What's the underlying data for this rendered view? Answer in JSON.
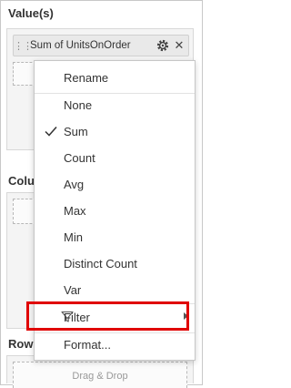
{
  "values_section": {
    "title": "Value(s)",
    "pill_label": "Sum of UnitsOnOrder",
    "close_glyph": "✕"
  },
  "columns_section": {
    "title": "Colu"
  },
  "rows_section": {
    "title": "Row",
    "drop_text": "Drag & Drop"
  },
  "menu": {
    "rename": "Rename",
    "items": [
      "None",
      "Sum",
      "Count",
      "Avg",
      "Max",
      "Min",
      "Distinct Count",
      "Var"
    ],
    "checked_item": "Sum",
    "filter": "Filter",
    "format": "Format..."
  },
  "colors": {
    "highlight": "#e00000",
    "menu_border": "#c6c6c6"
  }
}
